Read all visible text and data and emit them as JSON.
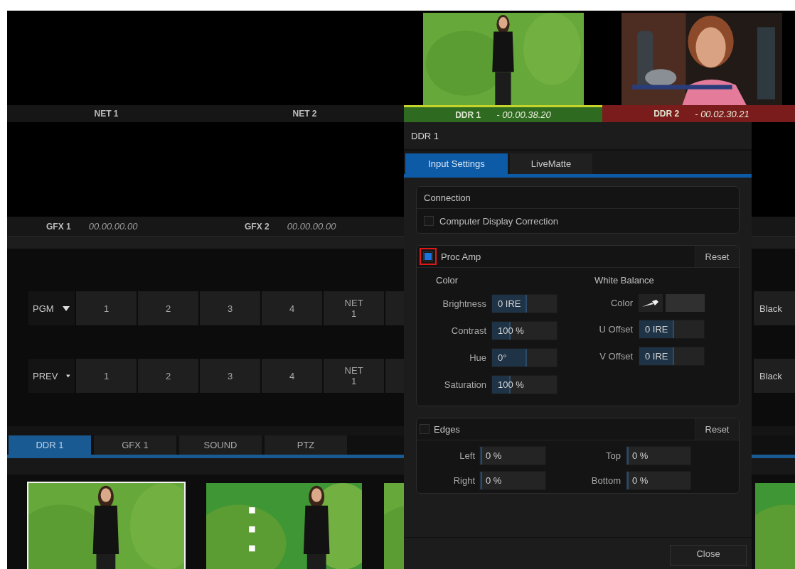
{
  "monitors": [
    {
      "label": "NET 1",
      "kind": "empty",
      "color": "#161616"
    },
    {
      "label": "NET 2",
      "kind": "empty",
      "color": "#161616"
    },
    {
      "label": "DDR 1",
      "timecode": "- 00.00.38.20",
      "kind": "picture",
      "color": "#2f6a21"
    },
    {
      "label": "DDR 2",
      "timecode": "- 00.02.30.21",
      "kind": "picture",
      "color": "#7b1c1c"
    }
  ],
  "monitors_row2": [
    {
      "label": "GFX 1",
      "timecode": "00.00.00.00"
    },
    {
      "label": "GFX 2",
      "timecode": "00.00.00.00"
    }
  ],
  "switcher": [
    {
      "label": "PGM",
      "sources": [
        "1",
        "2",
        "3",
        "4",
        "NET 1"
      ],
      "end_source": "Black"
    },
    {
      "label": "PREV",
      "sources": [
        "1",
        "2",
        "3",
        "4",
        "NET 1"
      ],
      "end_source": "Black"
    }
  ],
  "bottom_tabs": [
    {
      "label": "DDR 1",
      "selected": true
    },
    {
      "label": "GFX 1",
      "selected": false
    },
    {
      "label": "SOUND",
      "selected": false
    },
    {
      "label": "PTZ",
      "selected": false
    }
  ],
  "media": [
    {
      "kind": "picture",
      "selected": true
    },
    {
      "kind": "picture",
      "selected": false
    },
    {
      "kind": "picture",
      "selected": false
    },
    {
      "kind": "picture",
      "selected": false
    }
  ],
  "dialog": {
    "title": "DDR 1",
    "tabs": [
      {
        "label": "Input Settings",
        "selected": true
      },
      {
        "label": "LiveMatte",
        "selected": false
      }
    ],
    "connection": {
      "title": "Connection",
      "options": [
        {
          "label": "Computer Display Correction",
          "checked": false
        }
      ]
    },
    "proc_amp": {
      "label": "Proc Amp",
      "checked": true,
      "highlighted": true,
      "reset": "Reset",
      "color": {
        "heading": "Color",
        "fields": [
          {
            "label": "Brightness",
            "value": "0 IRE",
            "level": 0.5
          },
          {
            "label": "Contrast",
            "value": "100 %",
            "level": 0.25
          },
          {
            "label": "Hue",
            "value": "0°",
            "level": 0.5
          },
          {
            "label": "Saturation",
            "value": "100 %",
            "level": 0.25
          }
        ]
      },
      "white_balance": {
        "heading": "White Balance",
        "color_label": "Color",
        "fields": [
          {
            "label": "U Offset",
            "value": "0 IRE",
            "level": 0.5
          },
          {
            "label": "V Offset",
            "value": "0 IRE",
            "level": 0.5
          }
        ]
      }
    },
    "edges": {
      "label": "Edges",
      "checked": false,
      "reset": "Reset",
      "columns": [
        [
          {
            "label": "Left",
            "value": "0 %",
            "level": 0
          },
          {
            "label": "Right",
            "value": "0 %",
            "level": 0
          }
        ],
        [
          {
            "label": "Top",
            "value": "0 %",
            "level": 0
          },
          {
            "label": "Bottom",
            "value": "0 %",
            "level": 0
          }
        ]
      ]
    },
    "close": "Close"
  }
}
